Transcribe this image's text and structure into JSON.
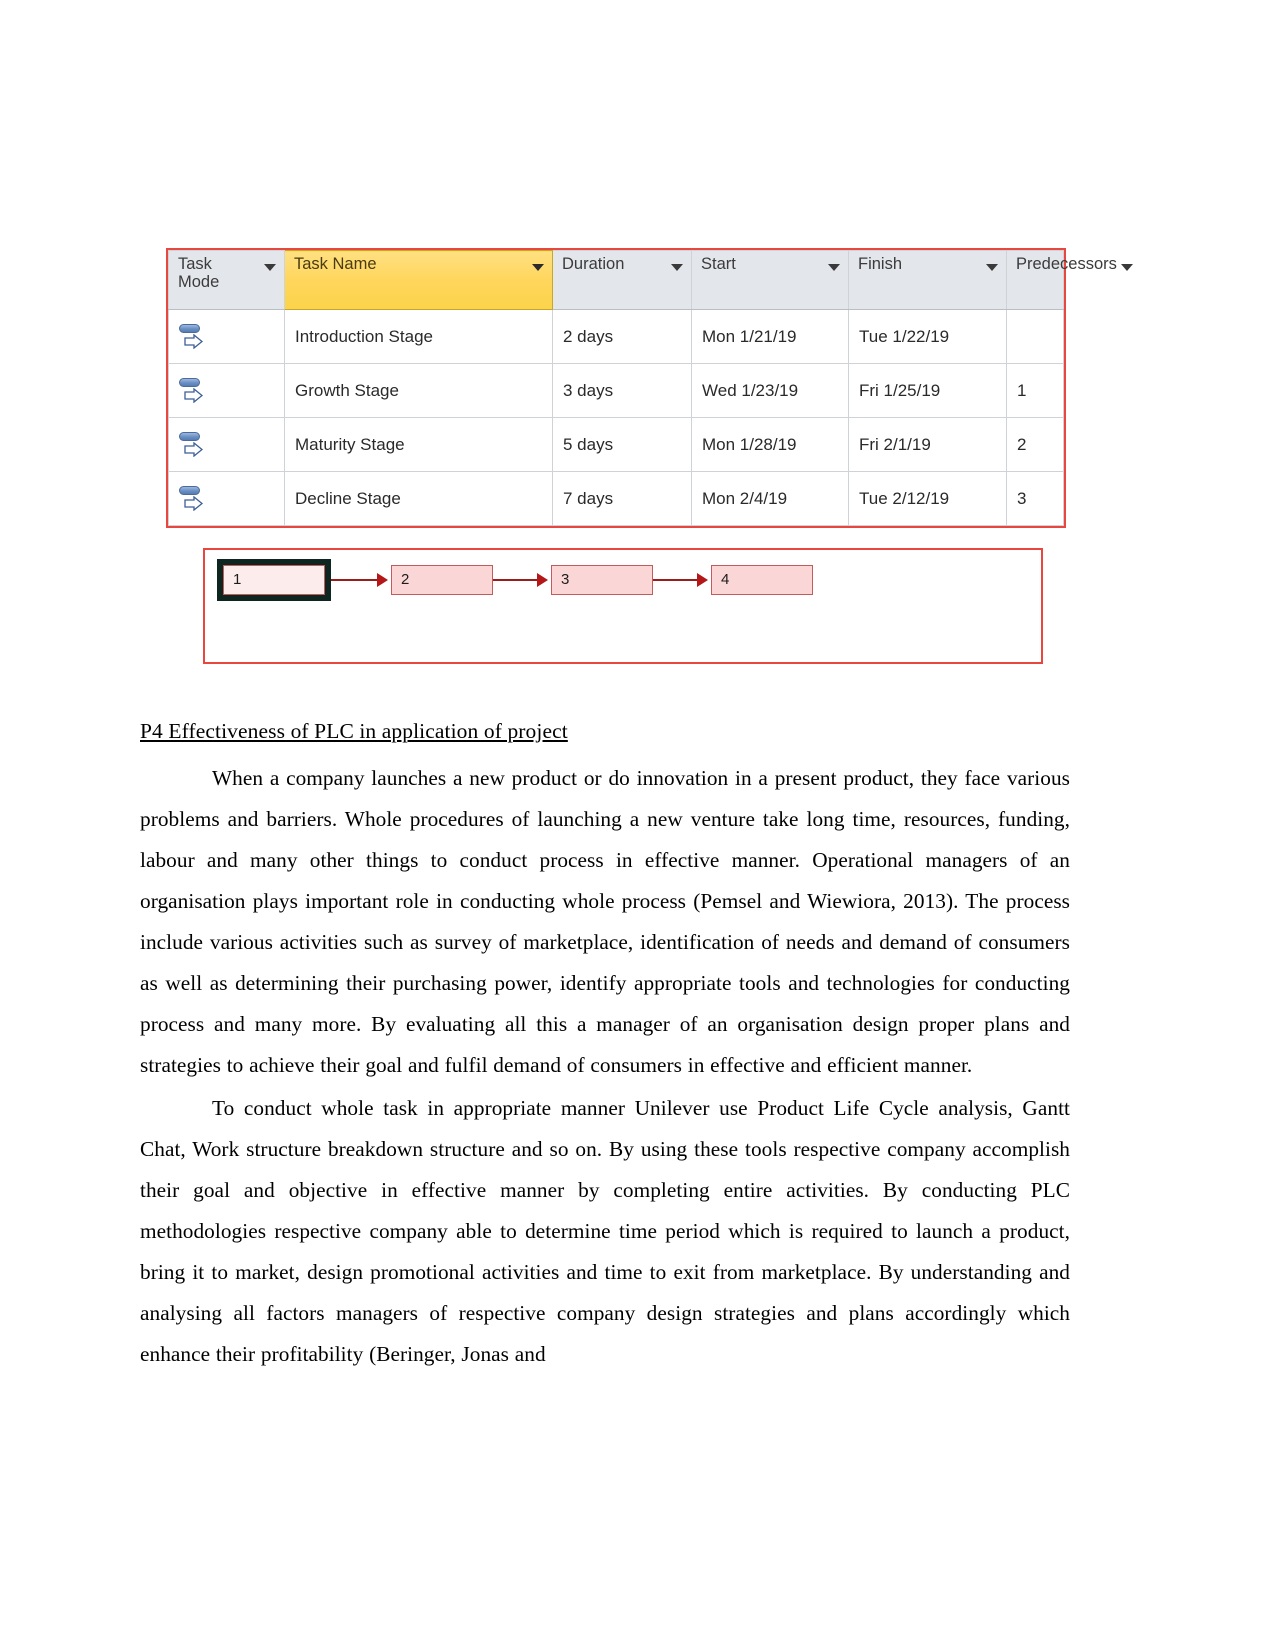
{
  "project_table": {
    "columns": [
      {
        "label": "Task\nMode",
        "has_filter": true,
        "highlighted": false
      },
      {
        "label": "Task Name",
        "has_filter": true,
        "highlighted": true
      },
      {
        "label": "Duration",
        "has_filter": true,
        "highlighted": false
      },
      {
        "label": "Start",
        "has_filter": true,
        "highlighted": false
      },
      {
        "label": "Finish",
        "has_filter": true,
        "highlighted": false
      },
      {
        "label": "Predecessors",
        "has_filter": true,
        "highlighted": false
      }
    ],
    "rows": [
      {
        "task_mode_icon": "auto-scheduled-icon",
        "task_name": "Introduction Stage",
        "duration": "2 days",
        "start": "Mon 1/21/19",
        "finish": "Tue 1/22/19",
        "predecessors": ""
      },
      {
        "task_mode_icon": "auto-scheduled-icon",
        "task_name": "Growth Stage",
        "duration": "3 days",
        "start": "Wed 1/23/19",
        "finish": "Fri 1/25/19",
        "predecessors": "1"
      },
      {
        "task_mode_icon": "auto-scheduled-icon",
        "task_name": "Maturity Stage",
        "duration": "5 days",
        "start": "Mon 1/28/19",
        "finish": "Fri 2/1/19",
        "predecessors": "2"
      },
      {
        "task_mode_icon": "auto-scheduled-icon",
        "task_name": "Decline Stage",
        "duration": "7 days",
        "start": "Mon 2/4/19",
        "finish": "Tue 2/12/19",
        "predecessors": "3"
      }
    ],
    "accent_colors": {
      "border": "#e8473f",
      "header_background": "#e3e6ea",
      "highlighted_header": "#ffd65c"
    }
  },
  "network_diagram": {
    "nodes": [
      {
        "label": "1",
        "selected": true
      },
      {
        "label": "2",
        "selected": false
      },
      {
        "label": "3",
        "selected": false
      },
      {
        "label": "4",
        "selected": false
      }
    ],
    "link_color": "#b31717",
    "node_fill": "#fbd6d6",
    "border_color": "#e8473f"
  },
  "document": {
    "heading": "P4 Effectiveness of PLC in application of project",
    "paragraphs": [
      "When a company launches a new product or do innovation in a present product, they face various problems and barriers. Whole procedures of launching a new venture take long time, resources, funding, labour and many other things to conduct process in effective manner. Operational managers of an organisation plays important role in conducting whole process (Pemsel and Wiewiora, 2013). The process include various activities such as survey of marketplace, identification of needs and demand of consumers as well as determining their purchasing power, identify appropriate tools and technologies for conducting process and many more. By evaluating all this a manager of an organisation design proper plans and strategies to achieve their goal and fulfil demand of consumers in effective and efficient manner.",
      "To conduct whole task in appropriate manner Unilever use Product Life Cycle analysis, Gantt Chat, Work structure breakdown structure and so on. By using these tools respective company accomplish their goal and objective in effective manner by completing entire activities. By conducting PLC methodologies respective company able to determine time period which is required to launch a product, bring it to market, design promotional activities and time to exit from marketplace. By understanding and analysing all factors managers of respective company design strategies and plans accordingly which enhance their profitability (Beringer, Jonas and"
    ]
  }
}
